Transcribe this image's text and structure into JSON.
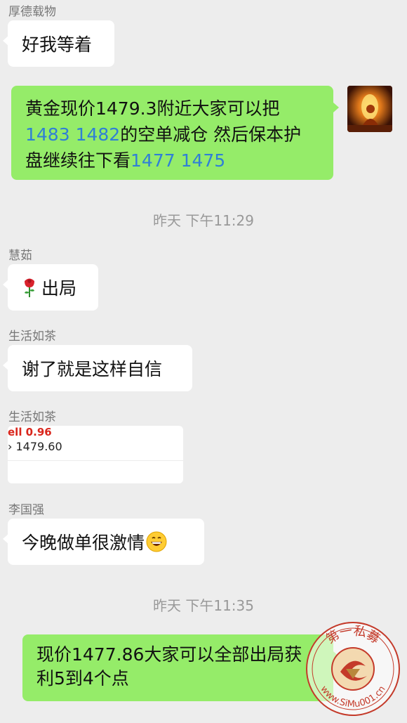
{
  "messages": [
    {
      "sender": "厚德载物",
      "text": "好我等着"
    },
    {
      "outgoing": true,
      "line1": "黄金现价1479.3附近大家可以把",
      "line2_num": "1483 1482",
      "line2_text": "的空单减仓 然后保本护",
      "line3_text": "盘继续往下看",
      "line3_num": "1477 1475"
    },
    {
      "timestamp": "昨天 下午11:29"
    },
    {
      "sender": "慧茹",
      "text": "出局"
    },
    {
      "sender": "生活如茶",
      "text": "谢了就是这样自信"
    },
    {
      "sender": "生活如茶",
      "image_line1": "ell 0.96",
      "image_line2": "› 1479.60"
    },
    {
      "sender": "李国强",
      "text": "今晚做单很激情"
    },
    {
      "timestamp": "昨天 下午11:35"
    },
    {
      "outgoing": true,
      "line1": "现价1477.86大家可以全部出局获",
      "line2": "利5到4个点"
    }
  ],
  "watermark": {
    "top_text": "第一私募",
    "bottom_text": "www.SiMu001.cn"
  },
  "colors": {
    "outgoing_bubble": "#95ec69",
    "incoming_bubble": "#ffffff",
    "background": "#ededed",
    "highlight_number": "#2f7fd6"
  },
  "icons": {
    "rose": "rose-emoji",
    "grin": "grinning-emoji"
  }
}
